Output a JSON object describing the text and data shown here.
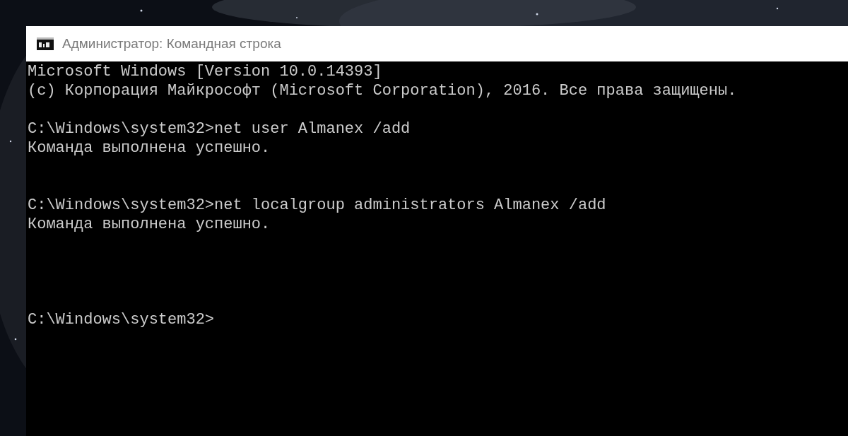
{
  "window": {
    "title": "Администратор: Командная строка"
  },
  "console": {
    "lines": [
      {
        "kind": "text",
        "text": "Microsoft Windows [Version 10.0.14393]"
      },
      {
        "kind": "text",
        "text": "(c) Корпорация Майкрософт (Microsoft Corporation), 2016. Все права защищены."
      },
      {
        "kind": "blank"
      },
      {
        "kind": "text",
        "text": "C:\\Windows\\system32>net user Almanex /add"
      },
      {
        "kind": "text",
        "text": "Команда выполнена успешно."
      },
      {
        "kind": "blank"
      },
      {
        "kind": "blank"
      },
      {
        "kind": "text",
        "text": "C:\\Windows\\system32>net localgroup administrators Almanex /add"
      },
      {
        "kind": "text",
        "text": "Команда выполнена успешно."
      },
      {
        "kind": "blank"
      },
      {
        "kind": "blank"
      },
      {
        "kind": "blank"
      },
      {
        "kind": "blank"
      },
      {
        "kind": "text",
        "text": "C:\\Windows\\system32>"
      }
    ]
  }
}
